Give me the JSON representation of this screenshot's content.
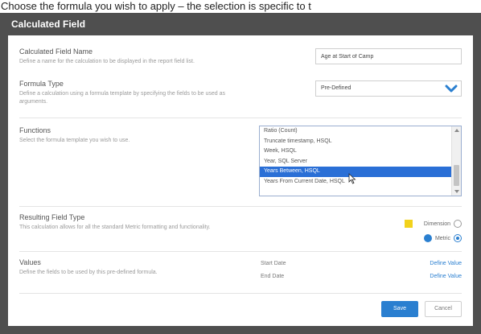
{
  "caption": "Choose the formula you wish to apply – the selection is specific to t",
  "dialog": {
    "title": "Calculated Field",
    "name_section": {
      "label": "Calculated Field Name",
      "description": "Define a name for the calculation to be displayed in the report field list.",
      "value": "Age at Start of Camp"
    },
    "formula_type": {
      "label": "Formula Type",
      "description": "Define a calculation using a formula template by specifying the fields to be used as arguments.",
      "selected": "Pre-Defined",
      "chevron_color": "#2a7fd0"
    },
    "functions": {
      "label": "Functions",
      "description": "Select the formula template you wish to use.",
      "items": [
        "Ratio (Count)",
        "Truncate timestamp, HSQL",
        "Week, HSQL",
        "Year, SQL Server",
        "Years Between, HSQL",
        "Years From Current Date, HSQL"
      ],
      "selected_index": 4,
      "selection_color": "#2a6fd6"
    },
    "resulting_field_type": {
      "label": "Resulting Field Type",
      "description": "This calculation allows for all the standard Metric formatting and functionality.",
      "options": [
        {
          "label": "Dimension",
          "swatch_color": "#f2d21c",
          "selected": false
        },
        {
          "label": "Metric",
          "swatch_color": "#2a7fd0",
          "selected": true
        }
      ]
    },
    "values": {
      "label": "Values",
      "description": "Define the fields to be used by this pre-defined formula.",
      "rows": [
        {
          "label": "Start Date",
          "link": "Define Value"
        },
        {
          "label": "End Date",
          "link": "Define Value"
        }
      ]
    },
    "buttons": {
      "save": "Save",
      "cancel": "Cancel"
    }
  }
}
